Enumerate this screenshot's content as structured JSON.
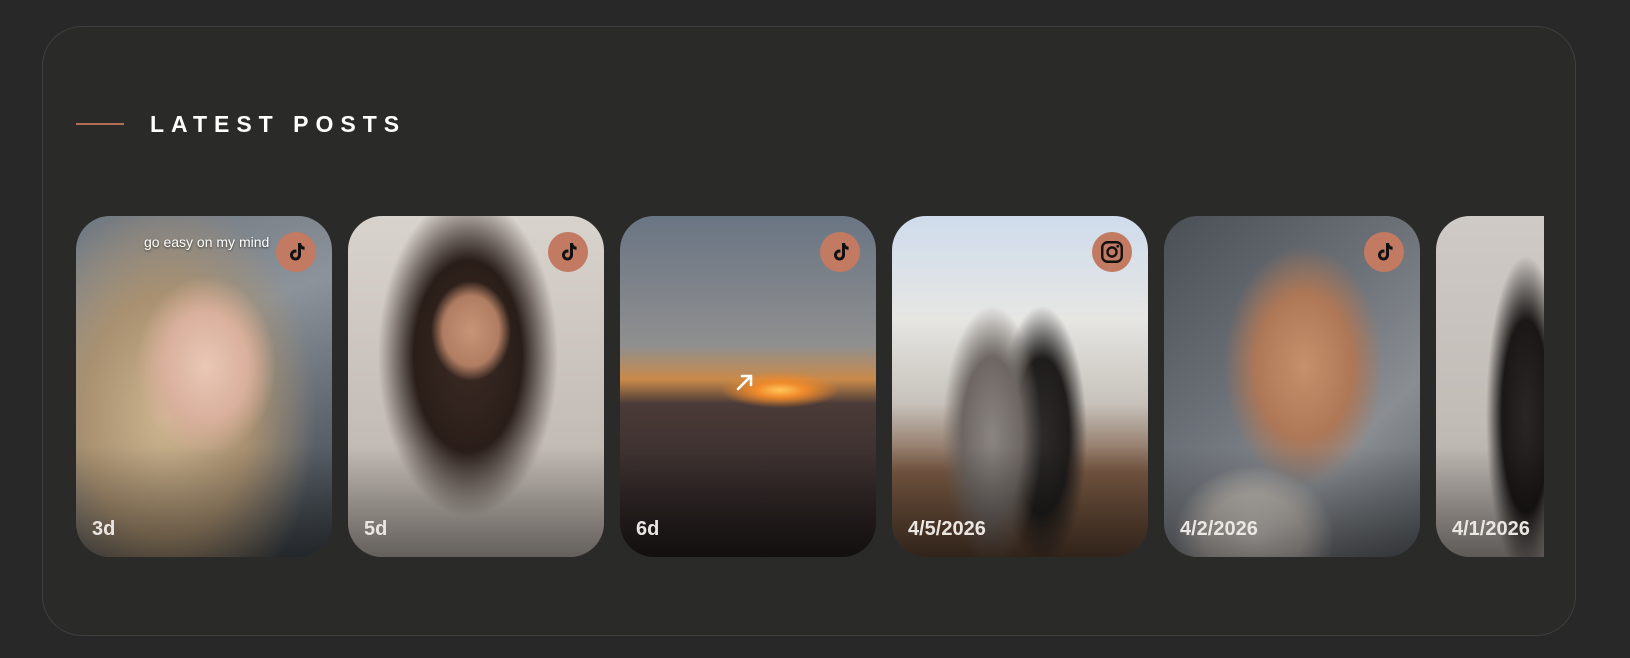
{
  "section": {
    "title": "LATEST POSTS",
    "accent_color": "#b46e55"
  },
  "posts": [
    {
      "date": "3d",
      "platform": "tiktok-icon",
      "caption": "go easy on my mind"
    },
    {
      "date": "5d",
      "platform": "tiktok-icon"
    },
    {
      "date": "6d",
      "platform": "tiktok-icon",
      "overlay_icon": "external-link-arrow-icon"
    },
    {
      "date": "4/5/2026",
      "platform": "instagram-icon"
    },
    {
      "date": "4/2/2026",
      "platform": "tiktok-icon"
    },
    {
      "date": "4/1/2026"
    }
  ]
}
